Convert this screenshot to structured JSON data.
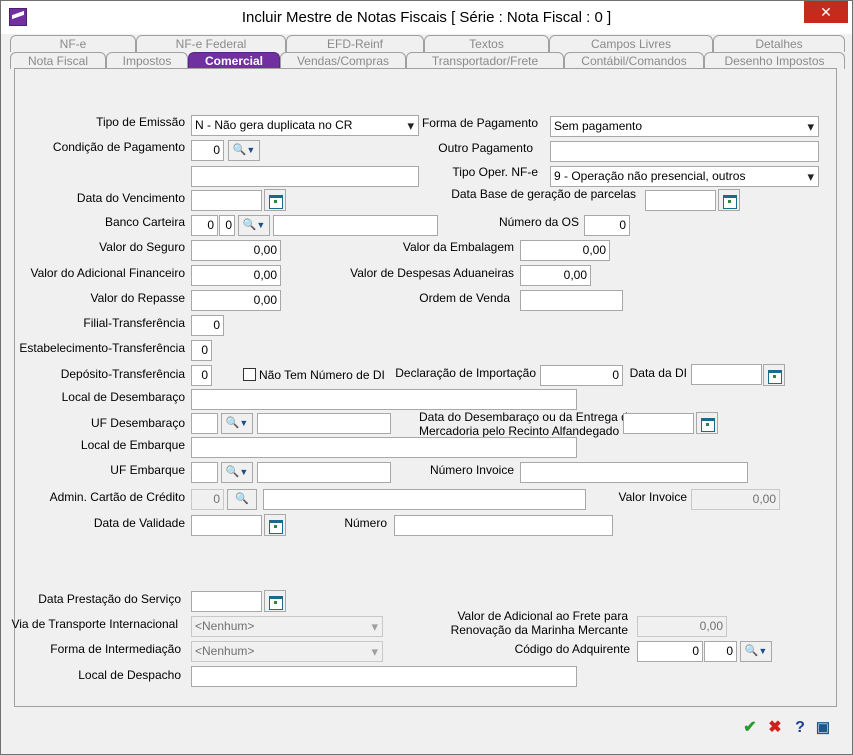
{
  "window": {
    "title": "Incluir Mestre de Notas Fiscais [ Série :      Nota Fiscal : 0 ]"
  },
  "tabs_top": [
    "NF-e",
    "NF-e Federal",
    "EFD-Reinf",
    "Textos",
    "Campos Livres",
    "Detalhes"
  ],
  "tabs_bottom": [
    "Nota Fiscal",
    "Impostos",
    "Comercial",
    "Vendas/Compras",
    "Transportador/Frete",
    "Contábil/Comandos",
    "Desenho Impostos"
  ],
  "form": {
    "tipo_emissao": {
      "label": "Tipo de Emissão",
      "value": "N - Não gera duplicata no CR"
    },
    "forma_pagamento": {
      "label": "Forma de Pagamento",
      "value": "Sem pagamento"
    },
    "condicao_pagamento": {
      "label": "Condição de Pagamento",
      "value": "0"
    },
    "outro_pagamento": {
      "label": "Outro Pagamento",
      "value": ""
    },
    "tipo_oper": {
      "label": "Tipo Oper. NF-e",
      "value": "9 - Operação não presencial, outros"
    },
    "data_vencimento": {
      "label": "Data do Vencimento"
    },
    "data_base": {
      "label": "Data Base de geração de parcelas"
    },
    "banco_carteira": {
      "label": "Banco Carteira",
      "value1": "0",
      "value2": "0"
    },
    "numero_os": {
      "label": "Número da OS",
      "value": "0"
    },
    "valor_seguro": {
      "label": "Valor do Seguro",
      "value": "0,00"
    },
    "valor_embalagem": {
      "label": "Valor da Embalagem",
      "value": "0,00"
    },
    "valor_adicional": {
      "label": "Valor do Adicional Financeiro",
      "value": "0,00"
    },
    "valor_despesas": {
      "label": "Valor de Despesas Aduaneiras",
      "value": "0,00"
    },
    "valor_repasse": {
      "label": "Valor do Repasse",
      "value": "0,00"
    },
    "ordem_venda": {
      "label": "Ordem de Venda"
    },
    "filial_transf": {
      "label": "Filial-Transferência",
      "value": "0"
    },
    "estab_transf": {
      "label": "Estabelecimento-Transferência",
      "value": "0"
    },
    "deposito_transf": {
      "label": "Depósito-Transferência",
      "value": "0"
    },
    "nao_tem_di": {
      "label": "Não Tem Número de DI"
    },
    "declaracao_importacao": {
      "label": "Declaração de Importação",
      "value": "0"
    },
    "data_di": {
      "label": "Data da DI"
    },
    "local_desembaraco": {
      "label": "Local de Desembaraço"
    },
    "uf_desembaraco": {
      "label": "UF Desembaraço"
    },
    "data_desembaraco": {
      "label1": "Data do Desembaraço ou da Entrega da",
      "label2": "Mercadoria pelo Recinto Alfandegado"
    },
    "local_embarque": {
      "label": "Local de Embarque"
    },
    "uf_embarque": {
      "label": "UF Embarque"
    },
    "numero_invoice": {
      "label": "Número Invoice"
    },
    "admin_cartao": {
      "label": "Admin. Cartão de Crédito",
      "value": "0"
    },
    "valor_invoice": {
      "label": "Valor Invoice",
      "value": "0,00"
    },
    "data_validade": {
      "label": "Data de Validade"
    },
    "numero": {
      "label": "Número"
    },
    "data_prestacao": {
      "label": "Data Prestação do Serviço"
    },
    "via_transporte": {
      "label": "Via de Transporte Internacional",
      "value": "<Nenhum>"
    },
    "valor_adicional_frete": {
      "label1": "Valor de Adicional ao Frete para",
      "label2": "Renovação da Marinha Mercante",
      "value": "0,00"
    },
    "forma_intermediacao": {
      "label": "Forma de Intermediação",
      "value": "<Nenhum>"
    },
    "codigo_adquirente": {
      "label": "Código do Adquirente",
      "value1": "0",
      "value2": "0"
    },
    "local_despacho": {
      "label": "Local de Despacho"
    }
  },
  "footer": {
    "ok": "✔",
    "cancel": "✖",
    "help": "?",
    "print": "▣"
  },
  "colors": {
    "accent": "#7030a0",
    "close": "#c42b1c"
  }
}
